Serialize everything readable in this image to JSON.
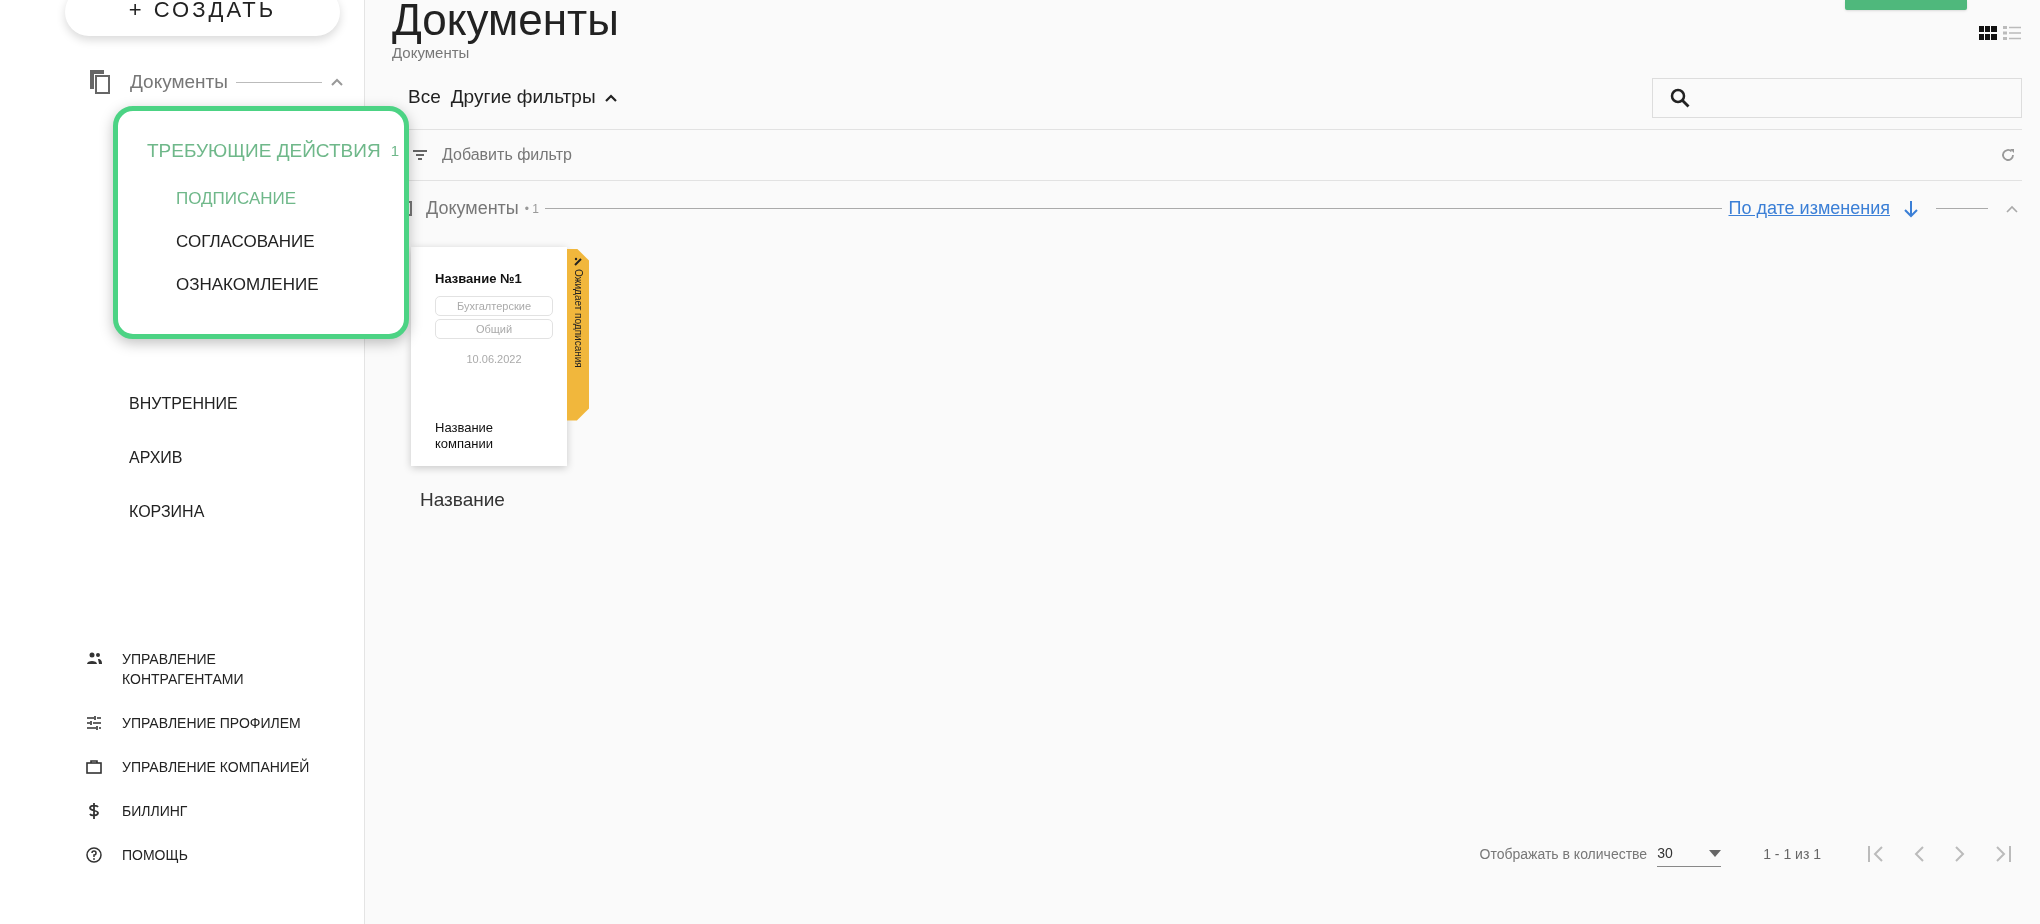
{
  "create_button": {
    "label": "+ СОЗДАТЬ"
  },
  "sidebar": {
    "section": {
      "label": "Документы",
      "expanded": true
    },
    "items": [
      {
        "label": "ВНУТРЕННИЕ",
        "selected": false
      },
      {
        "label": "АРХИВ",
        "selected": false
      },
      {
        "label": "КОРЗИНА",
        "selected": false
      }
    ],
    "footer_items": [
      {
        "label": "УПРАВЛЕНИЕ КОНТРАГЕНТАМИ",
        "kind": "people"
      },
      {
        "label": "УПРАВЛЕНИЕ ПРОФИЛЕМ",
        "kind": "sliders"
      },
      {
        "label": "УПРАВЛЕНИЕ КОМПАНИЕЙ",
        "kind": "briefcase"
      },
      {
        "label": "БИЛЛИНГ",
        "kind": "dollar"
      },
      {
        "label": "ПОМОЩЬ",
        "kind": "help"
      }
    ]
  },
  "popup": {
    "title": "ТРЕБУЮЩИЕ ДЕЙСТВИЯ",
    "count": "1",
    "items": [
      {
        "label": "ПОДПИСАНИЕ",
        "selected": true
      },
      {
        "label": "СОГЛАСОВАНИЕ",
        "selected": false
      },
      {
        "label": "ОЗНАКОМЛЕНИЕ",
        "selected": false
      }
    ]
  },
  "page": {
    "title": "Документы",
    "breadcrumb": "Документы"
  },
  "view_toggle": [
    {
      "kind": "grid",
      "selected": true
    },
    {
      "kind": "list",
      "selected": false
    }
  ],
  "filters": {
    "all": "Все",
    "more": "Другие фильтры",
    "expanded": true,
    "add_filter": "Добавить фильтр"
  },
  "group": {
    "label": "Документы",
    "count": "• 1",
    "sort": "По дате изменения",
    "expanded": true
  },
  "documents": [
    {
      "title": "Название №1",
      "tags": [
        "Бухгалтерские",
        "Общий"
      ],
      "date": "10.06.2022",
      "company": "Название компании",
      "status": "Ожидает подписания",
      "name": "Название"
    }
  ],
  "pagination": {
    "label": "Отображать в количестве",
    "per_page": "30",
    "range": "1 - 1 из 1"
  }
}
